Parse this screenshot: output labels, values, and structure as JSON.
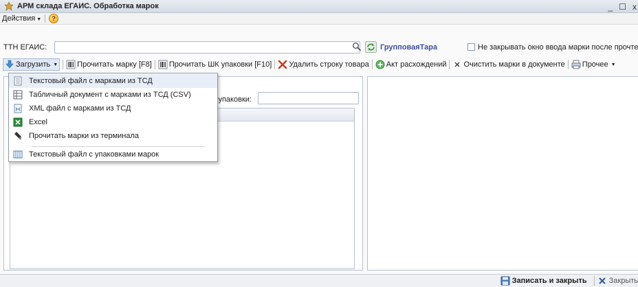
{
  "window": {
    "title": "АРМ склада ЕГАИС. Обработка марок",
    "controls": [
      "_",
      "☐",
      "x"
    ]
  },
  "menu": {
    "actions_label": "Действия",
    "help_label": "?"
  },
  "ttn": {
    "label": "ТТН ЕГАИС:",
    "value": "",
    "group_link": "ГрупповаяТара",
    "checkbox_label": "Не закрывать окно ввода марки после прочтения",
    "checkbox_checked": false
  },
  "toolbar": {
    "load_label": "Загрузить",
    "read_mark_label": "Прочитать марку [F8]",
    "read_pack_label": "Прочитать ШК упаковки [F10]",
    "delete_row_label": "Удалить строку товара",
    "discrepancy_label": "Акт расхождений",
    "clear_marks_label": "Очистить марки в документе",
    "other_label": "Прочее"
  },
  "pack": {
    "label": "д упаковки:",
    "value": ""
  },
  "dropdown": {
    "items": [
      {
        "label": "Текстовый файл с марками из ТСД",
        "icon": "text-file-icon"
      },
      {
        "label": "Табличный документ с марками из ТСД (CSV)",
        "icon": "table-icon"
      },
      {
        "label": "XML файл с марками из ТСД",
        "icon": "xml-file-icon"
      },
      {
        "label": "Excel",
        "icon": "excel-icon"
      },
      {
        "label": "Прочитать марки из терминала",
        "icon": "terminal-icon"
      },
      {
        "label": "Текстовый файл с упаковками марок",
        "icon": "pack-file-icon"
      }
    ]
  },
  "footer": {
    "save_close_label": "Записать и закрыть",
    "close_label": "Закрыть"
  },
  "colors": {
    "link": "#3b4fa0",
    "accent_panel": "#dfe8f4"
  }
}
